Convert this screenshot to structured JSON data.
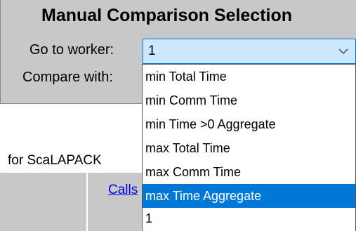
{
  "title": "Manual Comparison Selection",
  "go_to_worker": {
    "label": "Go to worker:",
    "value": "1"
  },
  "compare_with": {
    "label": "Compare with:",
    "options": [
      "min Total Time",
      "min Comm Time",
      "min Time >0 Aggregate",
      "max Total Time",
      "max Comm Time",
      "max Time Aggregate",
      "1"
    ],
    "highlighted": "max Time Aggregate"
  },
  "page_text": {
    "for_label": "for ScaLAPACK",
    "calls_link": "Calls"
  },
  "icons": {
    "dropdown": "chevron-down-icon"
  },
  "colors": {
    "panel": "#c8c8c8",
    "highlight": "#0078d7",
    "select_bg": "#cce8ff",
    "link": "#0000ee"
  }
}
